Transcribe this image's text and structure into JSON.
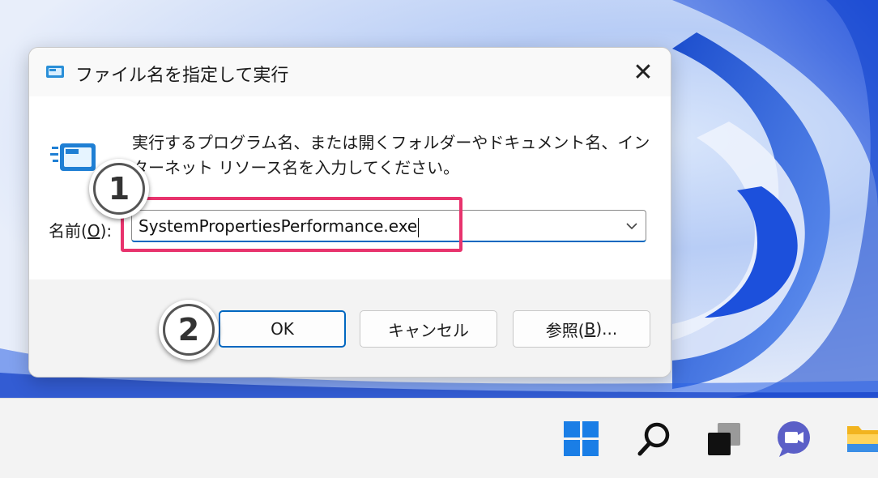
{
  "dialog": {
    "title": "ファイル名を指定して実行",
    "close_symbol": "✕",
    "description": "実行するプログラム名、または開くフォルダーやドキュメント名、インターネット リソース名を入力してください。",
    "name_label_prefix": "名前(",
    "name_label_key": "O",
    "name_label_suffix": "):",
    "input_value": "SystemPropertiesPerformance.exe",
    "buttons": {
      "ok": "OK",
      "cancel": "キャンセル",
      "browse_prefix": "参照(",
      "browse_key": "B",
      "browse_suffix": ")..."
    },
    "icons": {
      "title": "run-icon",
      "main": "run-icon",
      "close": "close-icon",
      "dropdown": "chevron-down-icon"
    }
  },
  "annotations": {
    "step1": "1",
    "step2": "2",
    "highlight_color": "#e8336d"
  },
  "taskbar": {
    "icons": [
      "windows-start-icon",
      "search-icon",
      "task-view-icon",
      "chat-icon",
      "file-explorer-icon"
    ]
  },
  "colors": {
    "accent": "#0067c0",
    "wallpaper_blue": "#1f5fe0"
  }
}
